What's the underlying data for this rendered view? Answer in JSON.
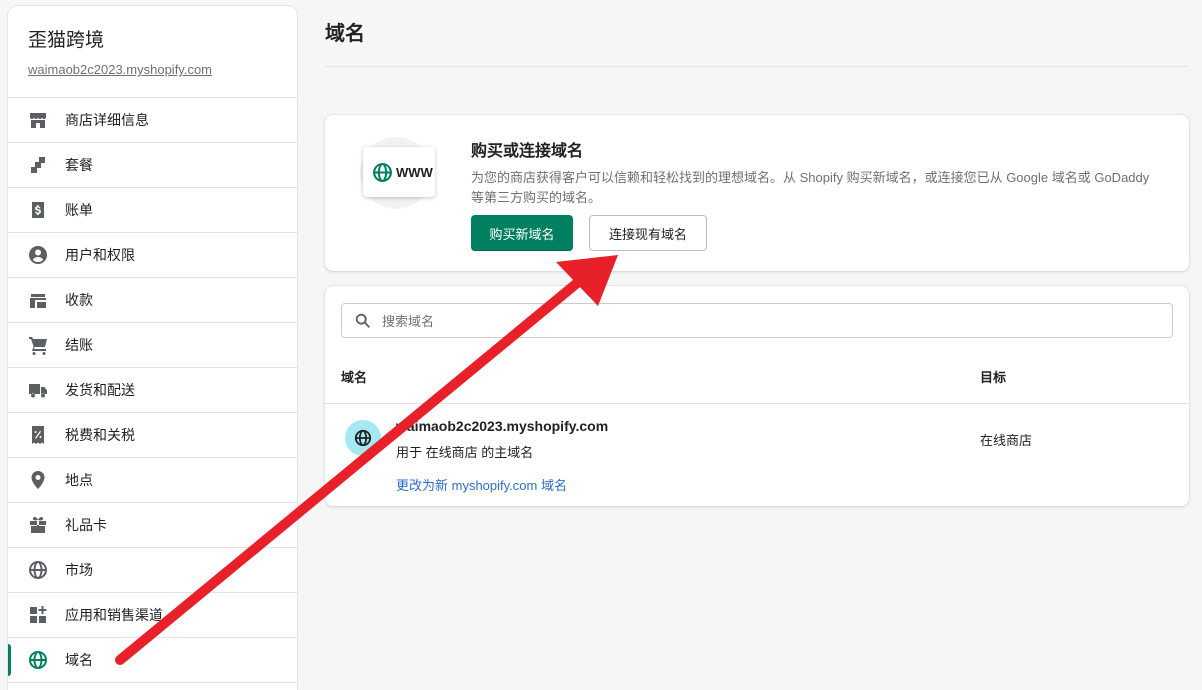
{
  "sidebar": {
    "store_name": "歪猫跨境",
    "store_url": "waimaob2c2023.myshopify.com",
    "items": [
      {
        "label": "商店详细信息",
        "icon": "store-icon"
      },
      {
        "label": "套餐",
        "icon": "plan-icon"
      },
      {
        "label": "账单",
        "icon": "billing-icon"
      },
      {
        "label": "用户和权限",
        "icon": "user-icon"
      },
      {
        "label": "收款",
        "icon": "payment-icon"
      },
      {
        "label": "结账",
        "icon": "cart-icon"
      },
      {
        "label": "发货和配送",
        "icon": "truck-icon"
      },
      {
        "label": "税费和关税",
        "icon": "tax-icon"
      },
      {
        "label": "地点",
        "icon": "location-icon"
      },
      {
        "label": "礼品卡",
        "icon": "gift-icon"
      },
      {
        "label": "市场",
        "icon": "globe-icon"
      },
      {
        "label": "应用和销售渠道",
        "icon": "apps-icon"
      },
      {
        "label": "域名",
        "icon": "domain-globe-icon",
        "active": true
      }
    ]
  },
  "page": {
    "title": "域名"
  },
  "promo": {
    "illustration_text": "WWW",
    "title": "购买或连接域名",
    "description": "为您的商店获得客户可以信赖和轻松找到的理想域名。从 Shopify 购买新域名，或连接您已从 Google 域名或 GoDaddy 等第三方购买的域名。",
    "buy_button": "购买新域名",
    "connect_button": "连接现有域名"
  },
  "domains": {
    "search_placeholder": "搜索域名",
    "col_domain": "域名",
    "col_target": "目标",
    "rows": [
      {
        "name": "waimaob2c2023.myshopify.com",
        "usage": "用于 在线商店 的主域名",
        "change_link": "更改为新 myshopify.com 域名",
        "target": "在线商店"
      }
    ]
  },
  "colors": {
    "accent": "#008060",
    "link": "#2c6ecb",
    "annotation_arrow": "#e8202a"
  }
}
